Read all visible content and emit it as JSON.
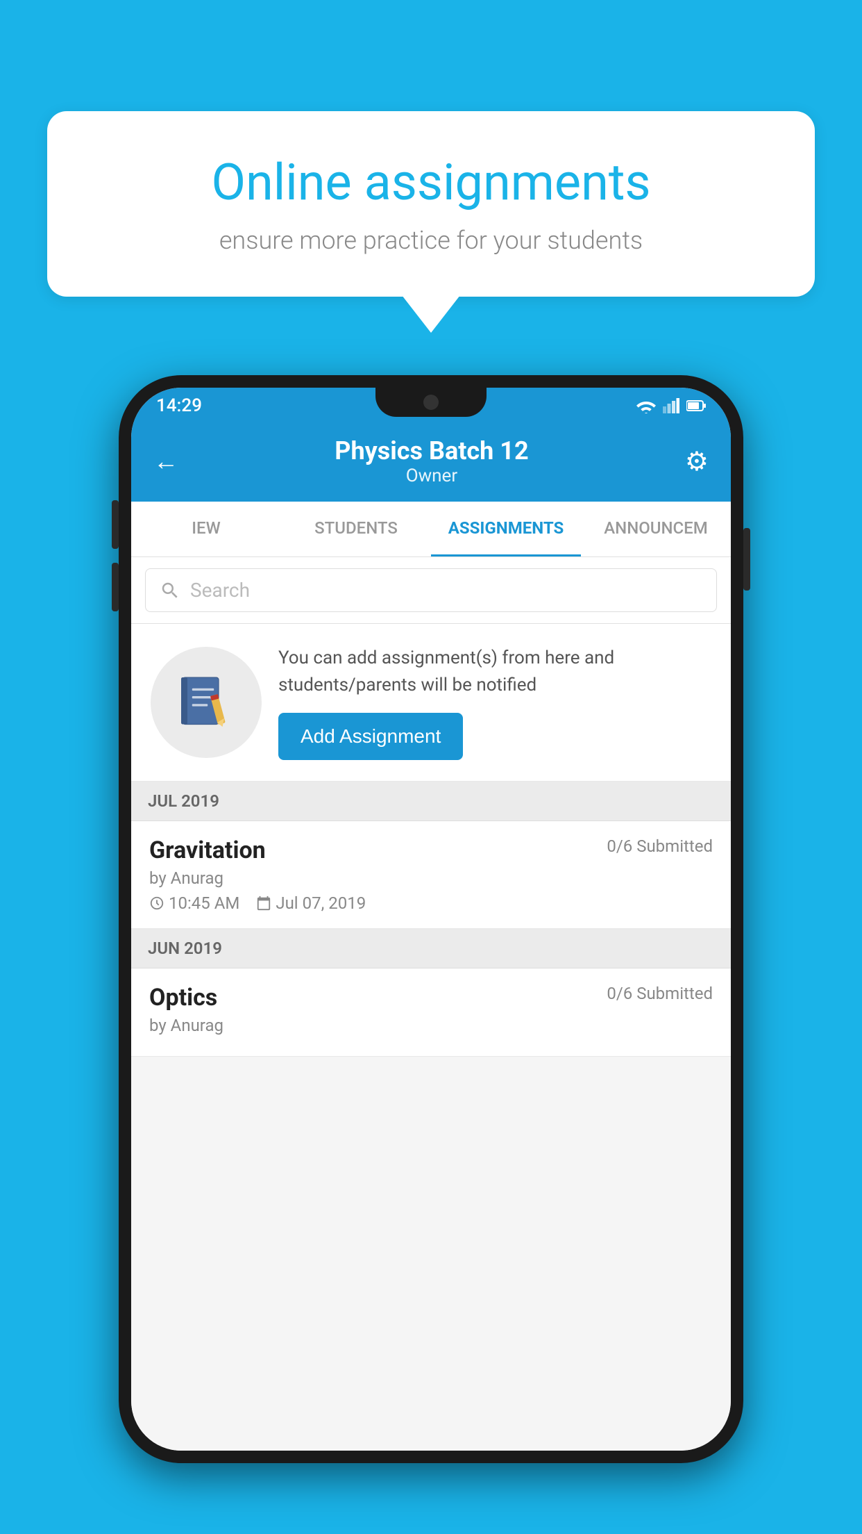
{
  "background_color": "#1ab3e8",
  "bubble": {
    "title": "Online assignments",
    "subtitle": "ensure more practice for your students"
  },
  "status_bar": {
    "time": "14:29"
  },
  "header": {
    "title": "Physics Batch 12",
    "subtitle": "Owner"
  },
  "tabs": [
    {
      "label": "IEW",
      "active": false
    },
    {
      "label": "STUDENTS",
      "active": false
    },
    {
      "label": "ASSIGNMENTS",
      "active": true
    },
    {
      "label": "ANNOUNCEM",
      "active": false
    }
  ],
  "search": {
    "placeholder": "Search"
  },
  "promo": {
    "description": "You can add assignment(s) from here and students/parents will be notified",
    "button_label": "Add Assignment"
  },
  "sections": [
    {
      "label": "JUL 2019",
      "assignments": [
        {
          "name": "Gravitation",
          "status": "0/6 Submitted",
          "author": "by Anurag",
          "time": "10:45 AM",
          "date": "Jul 07, 2019"
        }
      ]
    },
    {
      "label": "JUN 2019",
      "assignments": [
        {
          "name": "Optics",
          "status": "0/6 Submitted",
          "author": "by Anurag",
          "time": "",
          "date": ""
        }
      ]
    }
  ]
}
